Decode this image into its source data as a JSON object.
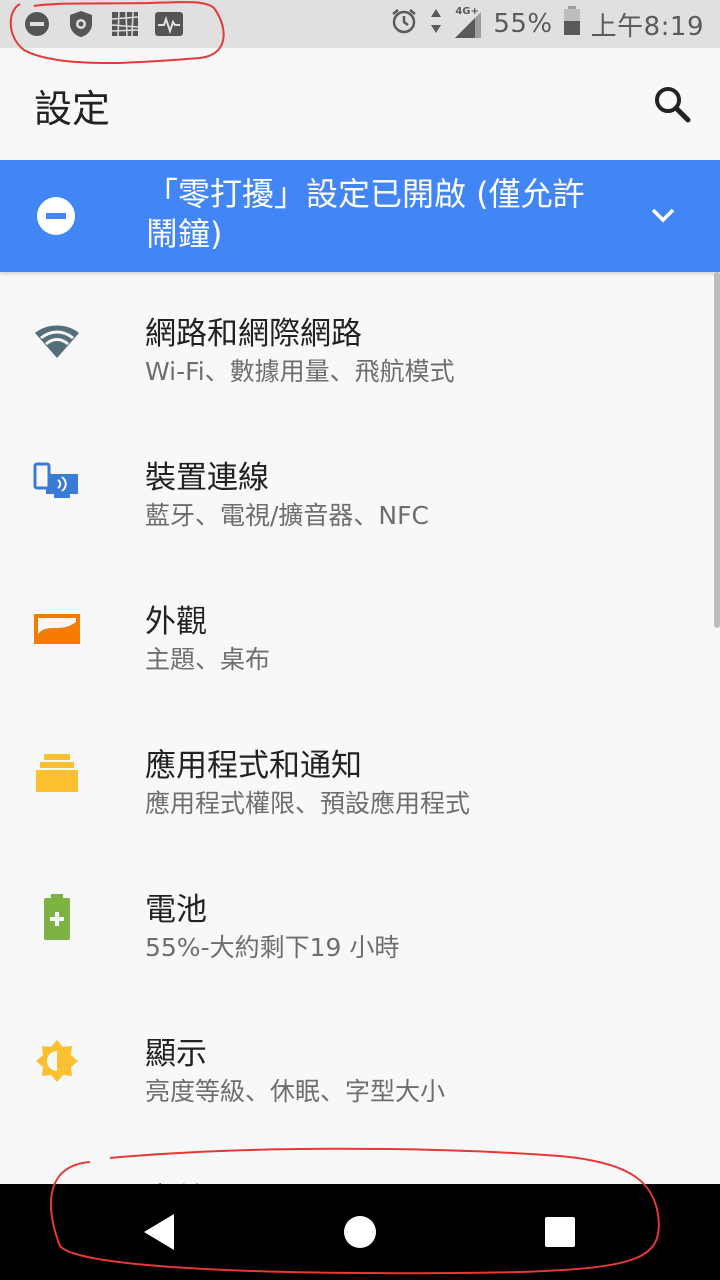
{
  "status_bar": {
    "left_icons": [
      "dnd-icon",
      "shield-icon",
      "signal-noise-icon",
      "activity-icon"
    ],
    "battery_percent": "55%",
    "time": "上午8:19",
    "network_label": "4G+"
  },
  "app_bar": {
    "title": "設定"
  },
  "dnd_banner": {
    "text": "「零打擾」設定已開啟 (僅允許鬧鐘)"
  },
  "items": [
    {
      "title": "網路和網際網路",
      "subtitle": "Wi-Fi、數據用量、飛航模式",
      "icon": "wifi-icon",
      "color": "#546e7a"
    },
    {
      "title": "裝置連線",
      "subtitle": "藍牙、電視/擴音器、NFC",
      "icon": "devices-icon",
      "color": "#3a7bd5"
    },
    {
      "title": "外觀",
      "subtitle": "主題、桌布",
      "icon": "wallpaper-icon",
      "color": "#f57c00"
    },
    {
      "title": "應用程式和通知",
      "subtitle": "應用程式權限、預設應用程式",
      "icon": "apps-icon",
      "color": "#fbc02d"
    },
    {
      "title": "電池",
      "subtitle": "55%-大約剩下19 小時",
      "icon": "battery-icon",
      "color": "#7cb342"
    },
    {
      "title": "顯示",
      "subtitle": "亮度等級、休眠、字型大小",
      "icon": "brightness-icon",
      "color": "#fbc02d"
    }
  ],
  "partial_item": {
    "title": "音效"
  },
  "colors": {
    "accent": "#4285f4",
    "annotation": "#e53935"
  }
}
